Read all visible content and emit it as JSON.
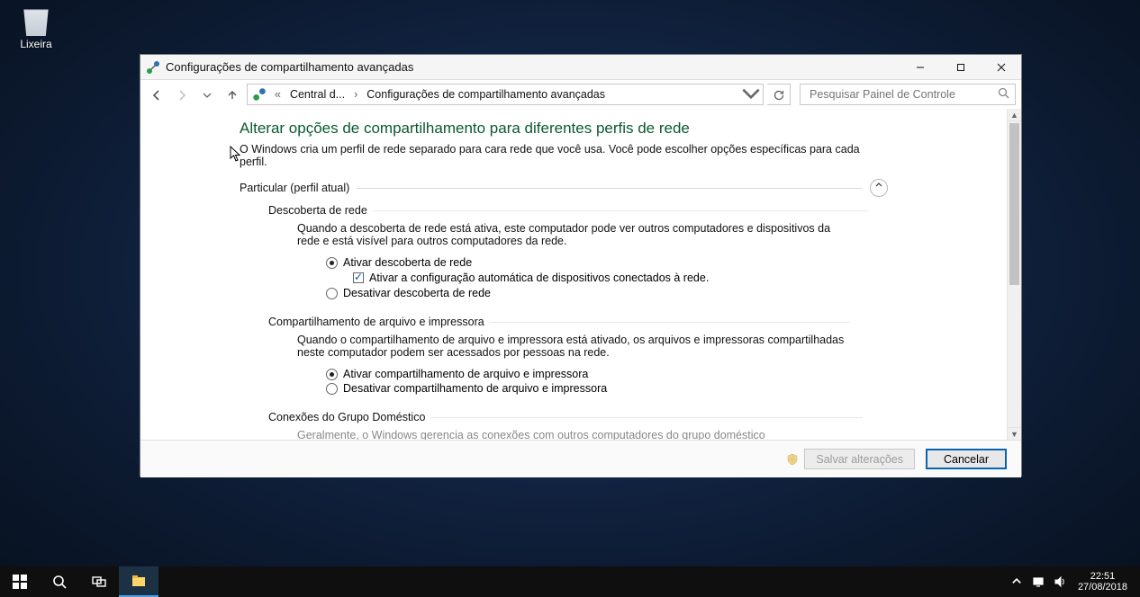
{
  "desktop": {
    "recycle_bin": "Lixeira"
  },
  "window": {
    "title": "Configurações de compartilhamento avançadas",
    "breadcrumb": {
      "part1": "Central d...",
      "part2": "Configurações de compartilhamento avançadas"
    },
    "search_placeholder": "Pesquisar Painel de Controle"
  },
  "page": {
    "heading": "Alterar opções de compartilhamento para diferentes perfis de rede",
    "intro": "O Windows cria um perfil de rede separado para cara rede que você usa. Você pode escolher opções específicas para cada perfil.",
    "profile_label": "Particular (perfil atual)",
    "network_discovery": {
      "title": "Descoberta de rede",
      "explain": "Quando a descoberta de rede está ativa, este computador pode ver outros computadores e dispositivos da rede e está visível para outros computadores da rede.",
      "opt_on": "Ativar descoberta de rede",
      "opt_auto": "Ativar a configuração automática de dispositivos conectados à rede.",
      "opt_off": "Desativar descoberta de rede",
      "selected": "on",
      "auto_checked": true
    },
    "file_share": {
      "title": "Compartilhamento de arquivo e impressora",
      "explain": "Quando o compartilhamento de arquivo e impressora está ativado, os arquivos e impressoras compartilhadas neste computador podem ser acessados por pessoas na rede.",
      "opt_on": "Ativar compartilhamento de arquivo e impressora",
      "opt_off": "Desativar compartilhamento de arquivo e impressora",
      "selected": "on"
    },
    "homegroup": {
      "title": "Conexões do Grupo Doméstico",
      "explain": "Geralmente, o Windows gerencia as conexões com outros computadores do grupo doméstico"
    }
  },
  "buttons": {
    "save": "Salvar alterações",
    "cancel": "Cancelar"
  },
  "taskbar": {
    "time": "22:51",
    "date": "27/08/2018"
  }
}
